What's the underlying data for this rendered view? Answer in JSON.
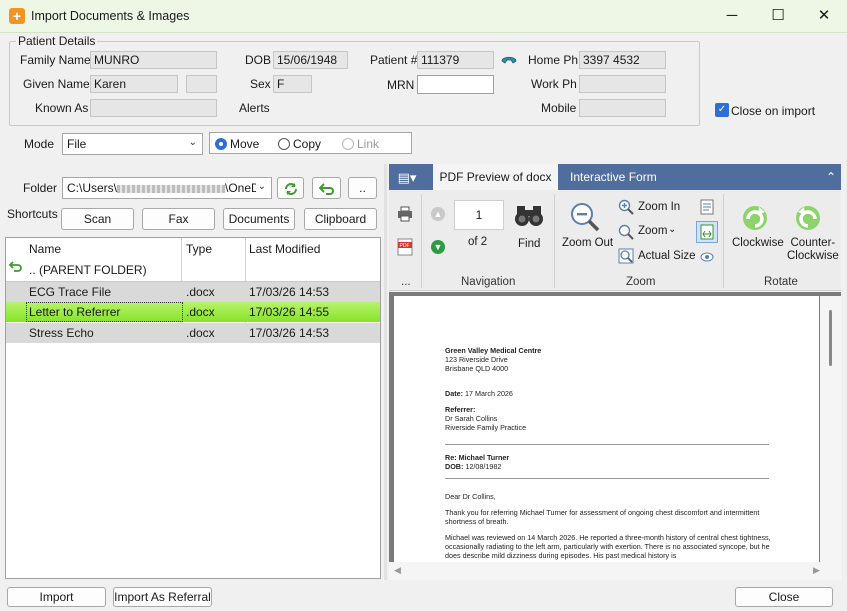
{
  "window": {
    "title": "Import Documents & Images",
    "minimize": "─",
    "maximize": "☐",
    "close": "✕"
  },
  "patient": {
    "legend": "Patient Details",
    "family_name_label": "Family Name",
    "family_name": "MUNRO",
    "given_name_label": "Given Name",
    "given_name": "Karen",
    "given_name_2": "",
    "known_as_label": "Known As",
    "known_as": "",
    "dob_label": "DOB",
    "dob": "15/06/1948",
    "sex_label": "Sex",
    "sex": "F",
    "alerts_label": "Alerts",
    "patient_no_label": "Patient #",
    "patient_no": "111379",
    "mrn_label": "MRN",
    "mrn": "",
    "home_ph_label": "Home Ph",
    "home_ph": "3397 4532",
    "work_ph_label": "Work Ph",
    "work_ph": "",
    "mobile_label": "Mobile",
    "mobile": ""
  },
  "close_on_import": {
    "label": "Close on import",
    "checked": true
  },
  "mode": {
    "label": "Mode",
    "value": "File",
    "move": "Move",
    "copy": "Copy",
    "link": "Link",
    "selected": "Move"
  },
  "folder": {
    "label": "Folder",
    "path_start": "C:\\Users\\",
    "path_end": "\\OneD",
    "up_label": ".."
  },
  "shortcuts": {
    "label": "Shortcuts",
    "buttons": [
      "Scan",
      "Fax",
      "Documents",
      "Clipboard"
    ]
  },
  "file_list": {
    "columns": [
      "Name",
      "Type",
      "Last Modified"
    ],
    "parent": ".. (PARENT FOLDER)",
    "rows": [
      {
        "name": "ECG Trace File",
        "type": ".docx",
        "modified": "17/03/26 14:53"
      },
      {
        "name": "Letter to Referrer",
        "type": ".docx",
        "modified": "17/03/26 14:55"
      },
      {
        "name": "Stress Echo",
        "type": ".docx",
        "modified": "17/03/26 14:53"
      }
    ],
    "selected_index": 1
  },
  "ribbon": {
    "tabs": [
      "PDF Preview of docx",
      "Interactive Form"
    ],
    "active_tab": 0,
    "more_label": "...",
    "navigation": {
      "label": "Navigation",
      "page": "1",
      "of": "of 2",
      "find": "Find"
    },
    "zoom": {
      "label": "Zoom",
      "zoom_out": "Zoom Out",
      "zoom_in": "Zoom In",
      "zoom": "Zoom",
      "actual_size": "Actual Size"
    },
    "rotate": {
      "label": "Rotate",
      "clockwise": "Clockwise",
      "counter_clockwise": "Counter-\nClockwise"
    }
  },
  "document": {
    "org": "Green Valley Medical Centre",
    "address1": "123 Riverside Drive",
    "address2": "Brisbane QLD 4000",
    "date_label": "Date:",
    "date": "17 March 2026",
    "referrer_label": "Referrer:",
    "referrer_name": "Dr Sarah Collins",
    "referrer_practice": "Riverside Family Practice",
    "re_label": "Re: Michael Turner",
    "dob_label": "DOB:",
    "dob": "12/08/1982",
    "salutation": "Dear Dr Collins,",
    "para1": "Thank you for referring Michael Turner for assessment of ongoing chest discomfort and intermittent shortness of breath.",
    "para2": "Michael was reviewed on 14 March 2026. He reported a three-month history of central chest tightness, occasionally radiating to the left arm, particularly with exertion. There is no associated syncope, but he does describe mild dizziness during episodes. His past medical history is"
  },
  "actions": {
    "import": "Import",
    "import_referral": "Import As Referral",
    "close": "Close"
  }
}
